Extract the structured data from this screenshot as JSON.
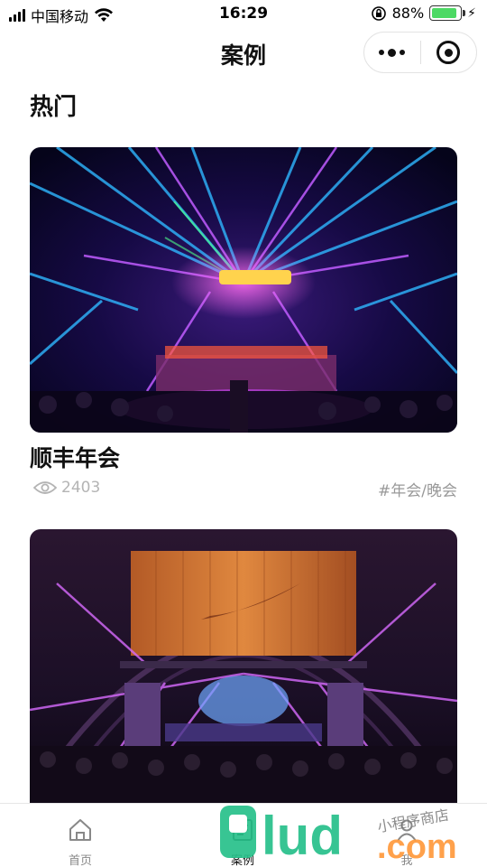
{
  "status_bar": {
    "carrier": "中国移动",
    "time": "16:29",
    "battery_percent": "88%",
    "battery_level": 0.88,
    "battery_color": "#4cd964"
  },
  "navbar": {
    "title": "案例",
    "menu_icon": "more-dots-icon",
    "close_icon": "miniprogram-close-icon"
  },
  "section": {
    "title": "热门"
  },
  "cases": [
    {
      "title": "顺丰年会",
      "views": "2403",
      "tag": "#年会/晚会",
      "image": "concert-stage-lights-photo"
    },
    {
      "image": "nike-summer-night-stage-photo"
    }
  ],
  "tabbar": {
    "items": [
      {
        "label": "首页",
        "icon": "home-icon",
        "active": false
      },
      {
        "label": "案例",
        "icon": "case-icon",
        "active": true
      },
      {
        "label": "我",
        "icon": "person-icon",
        "active": false
      }
    ]
  },
  "watermark": {
    "main": "9lud",
    "suffix": ".com",
    "note": "小程序商店"
  }
}
